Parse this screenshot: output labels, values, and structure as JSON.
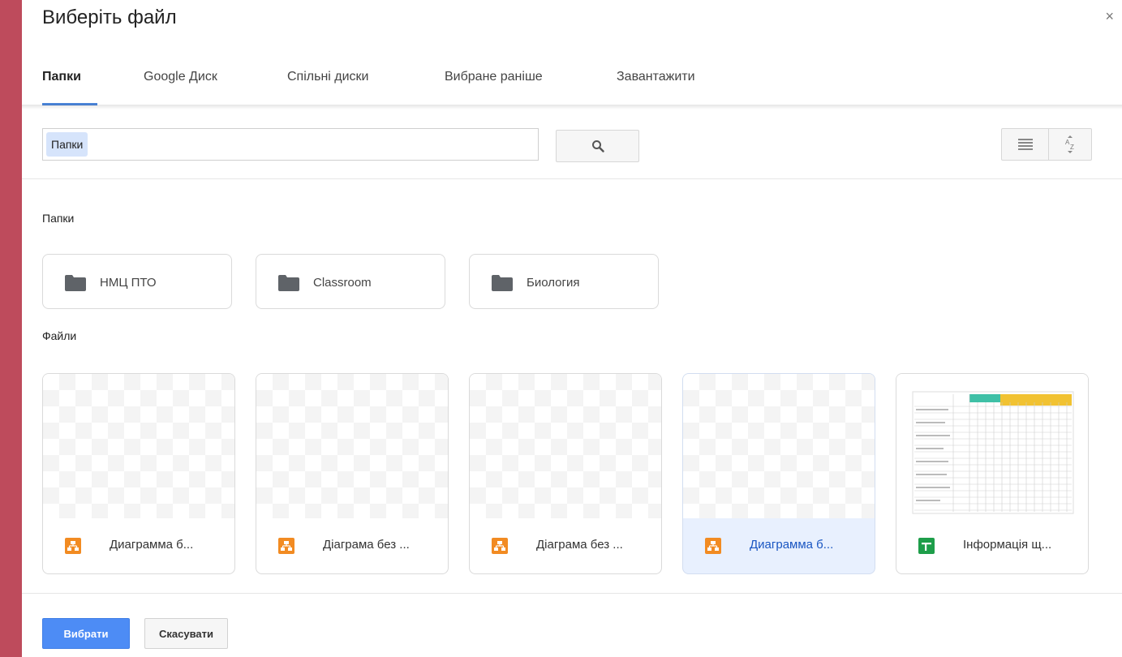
{
  "dialog": {
    "title": "Виберіть файл",
    "close_icon": "close-icon",
    "close_glyph": "×"
  },
  "tabs": [
    {
      "label": "Папки",
      "active": true
    },
    {
      "label": "Google Диск",
      "active": false
    },
    {
      "label": "Спільні диски",
      "active": false
    },
    {
      "label": "Вибране раніше",
      "active": false
    },
    {
      "label": "Завантажити",
      "active": false
    }
  ],
  "search": {
    "chip": "Папки",
    "value": "",
    "button_icon": "search-icon"
  },
  "view": {
    "list_icon": "list-view-icon",
    "sort_icon": "sort-az-icon",
    "sort_glyph_top": "A",
    "sort_glyph_bottom": "Z"
  },
  "folders_section": {
    "label": "Папки",
    "items": [
      {
        "name": "НМЦ ПТО",
        "icon": "folder-icon"
      },
      {
        "name": "Classroom",
        "icon": "folder-icon"
      },
      {
        "name": "Биология",
        "icon": "folder-icon"
      }
    ]
  },
  "files_section": {
    "label": "Файли",
    "items": [
      {
        "name": "Диаграмма б...",
        "icon": "drawing-icon",
        "selected": false
      },
      {
        "name": "Діаграма без ...",
        "icon": "drawing-icon",
        "selected": false
      },
      {
        "name": "Діаграма без ...",
        "icon": "drawing-icon",
        "selected": false
      },
      {
        "name": "Диаграмма б...",
        "icon": "drawing-icon",
        "selected": true
      },
      {
        "name": "Інформація щ...",
        "icon": "sheets-icon",
        "selected": false
      }
    ]
  },
  "footer": {
    "select_label": "Вибрати",
    "cancel_label": "Скасувати"
  },
  "colors": {
    "accent": "#4d8cf5",
    "tab_underline": "#4a84d8",
    "drawing_icon": "#f28b22",
    "sheets_icon": "#1e9e4a",
    "side_strip": "#be4b5c"
  }
}
